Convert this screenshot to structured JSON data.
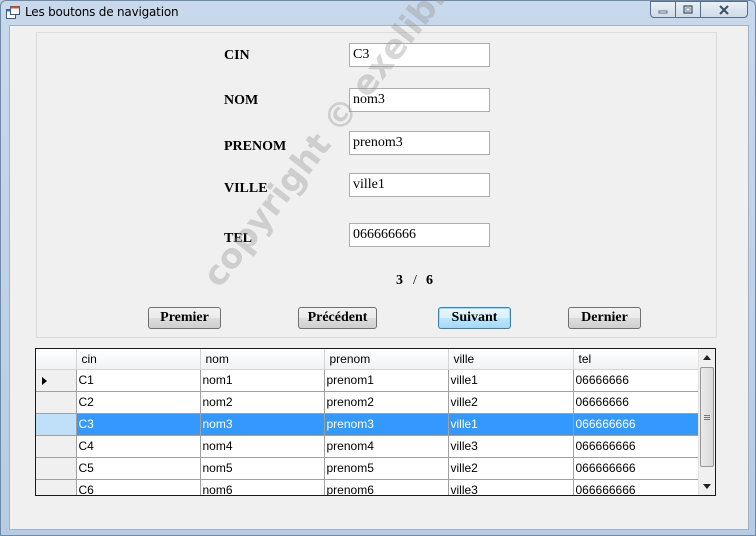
{
  "window": {
    "title": "Les boutons de navigation"
  },
  "form": {
    "fields": [
      {
        "label": "CIN",
        "value": "C3"
      },
      {
        "label": "NOM",
        "value": "nom3"
      },
      {
        "label": "PRENOM",
        "value": "prenom3"
      },
      {
        "label": "VILLE",
        "value": "ville1"
      },
      {
        "label": "TEL",
        "value": "066666666"
      }
    ],
    "position": {
      "current": "3",
      "separator": "/",
      "total": "6"
    }
  },
  "buttons": {
    "first": "Premier",
    "previous": "Précédent",
    "next": "Suivant",
    "last": "Dernier"
  },
  "grid": {
    "columns": [
      "cin",
      "nom",
      "prenom",
      "ville",
      "tel"
    ],
    "rows": [
      [
        "C1",
        "nom1",
        "prenom1",
        "ville1",
        "06666666"
      ],
      [
        "C2",
        "nom2",
        "prenom2",
        "ville2",
        "06666666"
      ],
      [
        "C3",
        "nom3",
        "prenom3",
        "ville1",
        "066666666"
      ],
      [
        "C4",
        "nom4",
        "prenom4",
        "ville3",
        "066666666"
      ],
      [
        "C5",
        "nom5",
        "prenom5",
        "ville2",
        "066666666"
      ],
      [
        "C6",
        "nom6",
        "prenom6",
        "ville3",
        "066666666"
      ]
    ],
    "selected_row": 3,
    "current_row": 1
  },
  "watermark": "copyright © exelib.net",
  "colors": {
    "selection": "#3399ff",
    "focused_button": "#3c7fb1"
  }
}
